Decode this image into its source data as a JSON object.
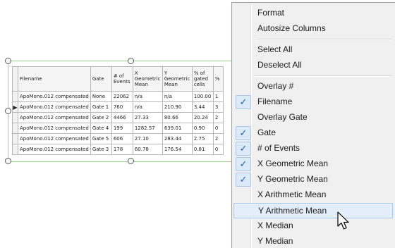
{
  "table": {
    "headers": [
      "Filename",
      "Gate",
      "# of Events",
      "X Geometric Mean",
      "Y Geometric Mean",
      "% of gated cells",
      "%"
    ],
    "rows": [
      [
        "ApoMono.012 compensated",
        "None",
        "22062",
        "n/a",
        "n/a",
        "100.00",
        "1"
      ],
      [
        "ApoMono.012 compensated",
        "Gate 1",
        "760",
        "n/a",
        "210.90",
        "3.44",
        "3"
      ],
      [
        "ApoMono.012 compensated",
        "Gate 2",
        "4466",
        "27.33",
        "80.66",
        "20.24",
        "2"
      ],
      [
        "ApoMono.012 compensated",
        "Gate 4",
        "199",
        "1282.57",
        "639.01",
        "0.90",
        "0"
      ],
      [
        "ApoMono.012 compensated",
        "Gate 5",
        "606",
        "27.10",
        "283.44",
        "2.75",
        "2"
      ],
      [
        "ApoMono.012 compensated",
        "Gate 3",
        "178",
        "60.78",
        "176.54",
        "0.81",
        "0"
      ]
    ],
    "current_row_marker": "▶"
  },
  "menu": {
    "format": "Format",
    "autosize_columns": "Autosize Columns",
    "select_all": "Select All",
    "deselect_all": "Deselect All",
    "overlay_num": "Overlay #",
    "filename": "Filename",
    "overlay_gate": "Overlay Gate",
    "gate": "Gate",
    "num_events": "# of Events",
    "x_geo_mean": "X Geometric Mean",
    "y_geo_mean": "Y Geometric Mean",
    "x_arith_mean": "X Arithmetic Mean",
    "y_arith_mean": "Y Arithmetic Mean",
    "x_median": "X Median",
    "y_median": "Y Median",
    "checkmark": "✓"
  },
  "checked": [
    "Filename",
    "Gate",
    "# of Events",
    "X Geometric Mean",
    "Y Geometric Mean"
  ],
  "highlighted": "Y Arithmetic Mean",
  "colors": {
    "selection_frame": "#9fcf8f",
    "check_blue": "#1c5fb5",
    "highlight_bg": "#e4eefa"
  }
}
